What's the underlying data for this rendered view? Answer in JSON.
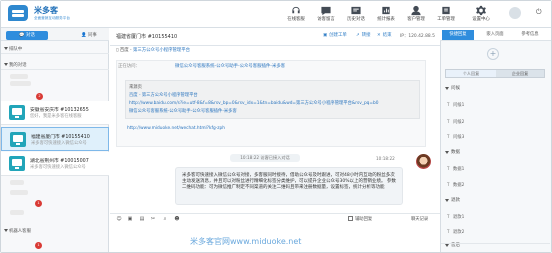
{
  "app": {
    "title": "米多客",
    "subtitle": "全面营销互动服务平台"
  },
  "header_nav": [
    {
      "label": "在线客服",
      "icon": "headset-icon"
    },
    {
      "label": "访客留言",
      "icon": "message-icon"
    },
    {
      "label": "历史对话",
      "icon": "history-icon"
    },
    {
      "label": "统计报表",
      "icon": "chart-icon"
    },
    {
      "label": "客户管理",
      "icon": "customer-icon"
    },
    {
      "label": "工单管理",
      "icon": "ticket-icon"
    },
    {
      "label": "设置中心",
      "icon": "settings-icon"
    }
  ],
  "sidebar": {
    "tabs": {
      "active": "对话",
      "inactive": "同事"
    },
    "sections": [
      {
        "label": "排队中"
      },
      {
        "label": "我的对话"
      }
    ],
    "conversations": [
      {
        "name": "安徽省安庆市 #10132655",
        "last": "您好，我是米多客在线客服"
      },
      {
        "name": "福建省厦门市 #10155410",
        "last": "米多客可快速接入微信公众号"
      },
      {
        "name": "湖北省荆州市 #10015007",
        "last": "米多客可快速接入微信公众号"
      }
    ],
    "bottom_section": "机器人客服",
    "badge_counts": [
      "2",
      "1",
      "1"
    ]
  },
  "chat": {
    "title": "福建省厦门市 #10155410",
    "header_actions": [
      {
        "label": "创建工单",
        "icon": "ticket-icon"
      },
      {
        "label": "转接",
        "icon": "transfer-icon"
      },
      {
        "label": "结束",
        "icon": "end-icon"
      }
    ],
    "ip": "IP：120.42.88.5",
    "breadcrumb_prefix": "百度 - ",
    "breadcrumb_link": "第三方公众号小程序管理平台",
    "visit_label": "正在访问：",
    "visit_links": "微信公众号客服系统-公众号助手-公众号客服插件-米多客",
    "source_title": "来源页",
    "source_lines": [
      "百度 - 第三方公众号小程序管理平台",
      "http://www.baidu.com/s?ie=utf-8&f=8&rsv_bp=0&rsv_idx=1&tn=baidu&wd=第三方公众号小程序管理平台&rsv_pq=b0",
      "微信公众号客服系统-公众号助手-公众号客服插件-米多客"
    ],
    "source_link": "http://www.miduoke.net/wechat.html?kfg-zph",
    "timestamp": "10:18:22 访客已接入对话",
    "message_time": "10:18:22",
    "message": "米多客可快速接入微信公众号对接，多客服同时接待，借助公众号及时跟进，可对48小时内互动的粉丝多次主动发送消息，并且可以对粉丝进行精细化标签分类维护，可以提升企业公众号30%以上的营销业绩。 参数二维码功能：可为微信推广制定不同渠道的关注二维码且带来注册数据量，设置标签，统计分析等功能",
    "toolbar_icons": [
      "smile-icon",
      "image-icon",
      "folder-icon",
      "scissors-icon",
      "screenshot-icon",
      "emoji-icon"
    ],
    "checkbox_label": "辅助回复",
    "history_label": "聊天记录"
  },
  "rightpanel": {
    "tabs": [
      "快捷回复",
      "嵌入页面",
      "参考信息"
    ],
    "subtabs": [
      "个人回复",
      "企业回复"
    ],
    "sections": [
      {
        "label": "问候",
        "items": [
          "问候1",
          "问候2",
          "问候3"
        ]
      },
      {
        "label": "数据",
        "items": [
          "数据1",
          "数据2"
        ]
      },
      {
        "label": "退款",
        "items": [
          "退款1",
          "退款2"
        ]
      },
      {
        "label": "售后",
        "items": []
      }
    ]
  },
  "watermark": "米多客官网www.miduoke.net"
}
